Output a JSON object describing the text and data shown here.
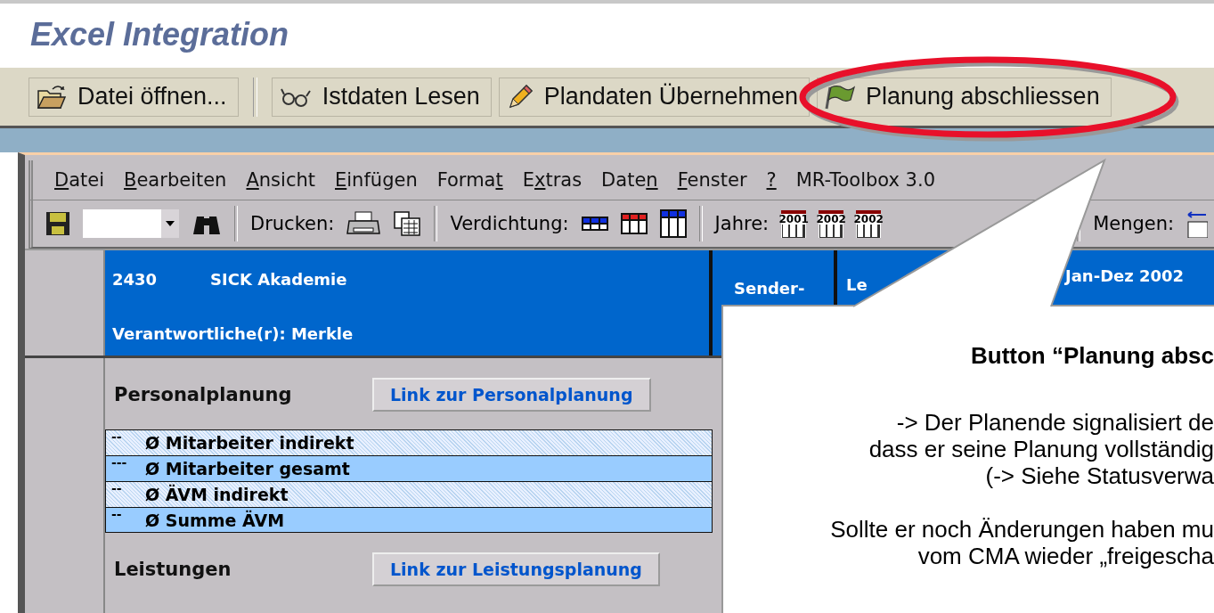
{
  "title": "Excel Integration",
  "toolbar": {
    "buttons": [
      {
        "label": "Datei öffnen...",
        "highlighted": false
      },
      {
        "label": "Istdaten Lesen",
        "highlighted": false
      },
      {
        "label": "Plandaten Übernehmen",
        "highlighted": false
      },
      {
        "label": "Planung abschliessen",
        "highlighted": true
      }
    ]
  },
  "excel": {
    "menu": [
      {
        "key": "D",
        "post": "atei"
      },
      {
        "key": "B",
        "post": "earbeiten"
      },
      {
        "key": "A",
        "post": "nsicht"
      },
      {
        "key": "E",
        "post": "infügen"
      },
      {
        "pre": "Forma",
        "key": "t"
      },
      {
        "pre": "E",
        "key": "x",
        "post": "tras"
      },
      {
        "pre": "Date",
        "key": "n"
      },
      {
        "key": "F",
        "post": "enster"
      },
      {
        "key": "?"
      },
      {
        "pre": "MR-Toolbox 3.0"
      }
    ],
    "toolbar": {
      "print_label": "Drucken:",
      "condense_label": "Verdichtung:",
      "years_label": "Jahre:",
      "years": [
        "2001",
        "2002",
        "2002"
      ],
      "amounts_label": "Mengen:"
    },
    "header": {
      "code": "2430",
      "name": "SICK Akademie",
      "responsible": "Verantwortliche(r): Merkle",
      "column_2": "Sender-",
      "column_3": "Le",
      "period": "Jan-Dez 2002"
    },
    "sections": [
      {
        "title": "Personalplanung",
        "link": "Link zur Personalplanung",
        "rows": [
          {
            "marker": "--",
            "label": "Ø Mitarbeiter indirekt",
            "kind": "dotted"
          },
          {
            "marker": "---",
            "label": "Ø Mitarbeiter gesamt",
            "kind": "solid"
          },
          {
            "marker": "--",
            "label": "Ø ÄVM indirekt",
            "kind": "dotted"
          },
          {
            "marker": "--",
            "label": "Ø Summe ÄVM",
            "kind": "solid"
          }
        ]
      },
      {
        "title": "Leistungen",
        "link": "Link zur Leistungsplanung"
      }
    ]
  },
  "callout": {
    "title": "Button “Planung absc",
    "paragraphs": [
      {
        "lines": [
          "-> Der Planende signalisiert de",
          "dass er seine Planung vollständig",
          "(-> Siehe Statusverwa"
        ]
      },
      {
        "lines": [
          "Sollte er noch Änderungen haben mu",
          "vom CMA wieder „freigescha"
        ]
      }
    ]
  }
}
